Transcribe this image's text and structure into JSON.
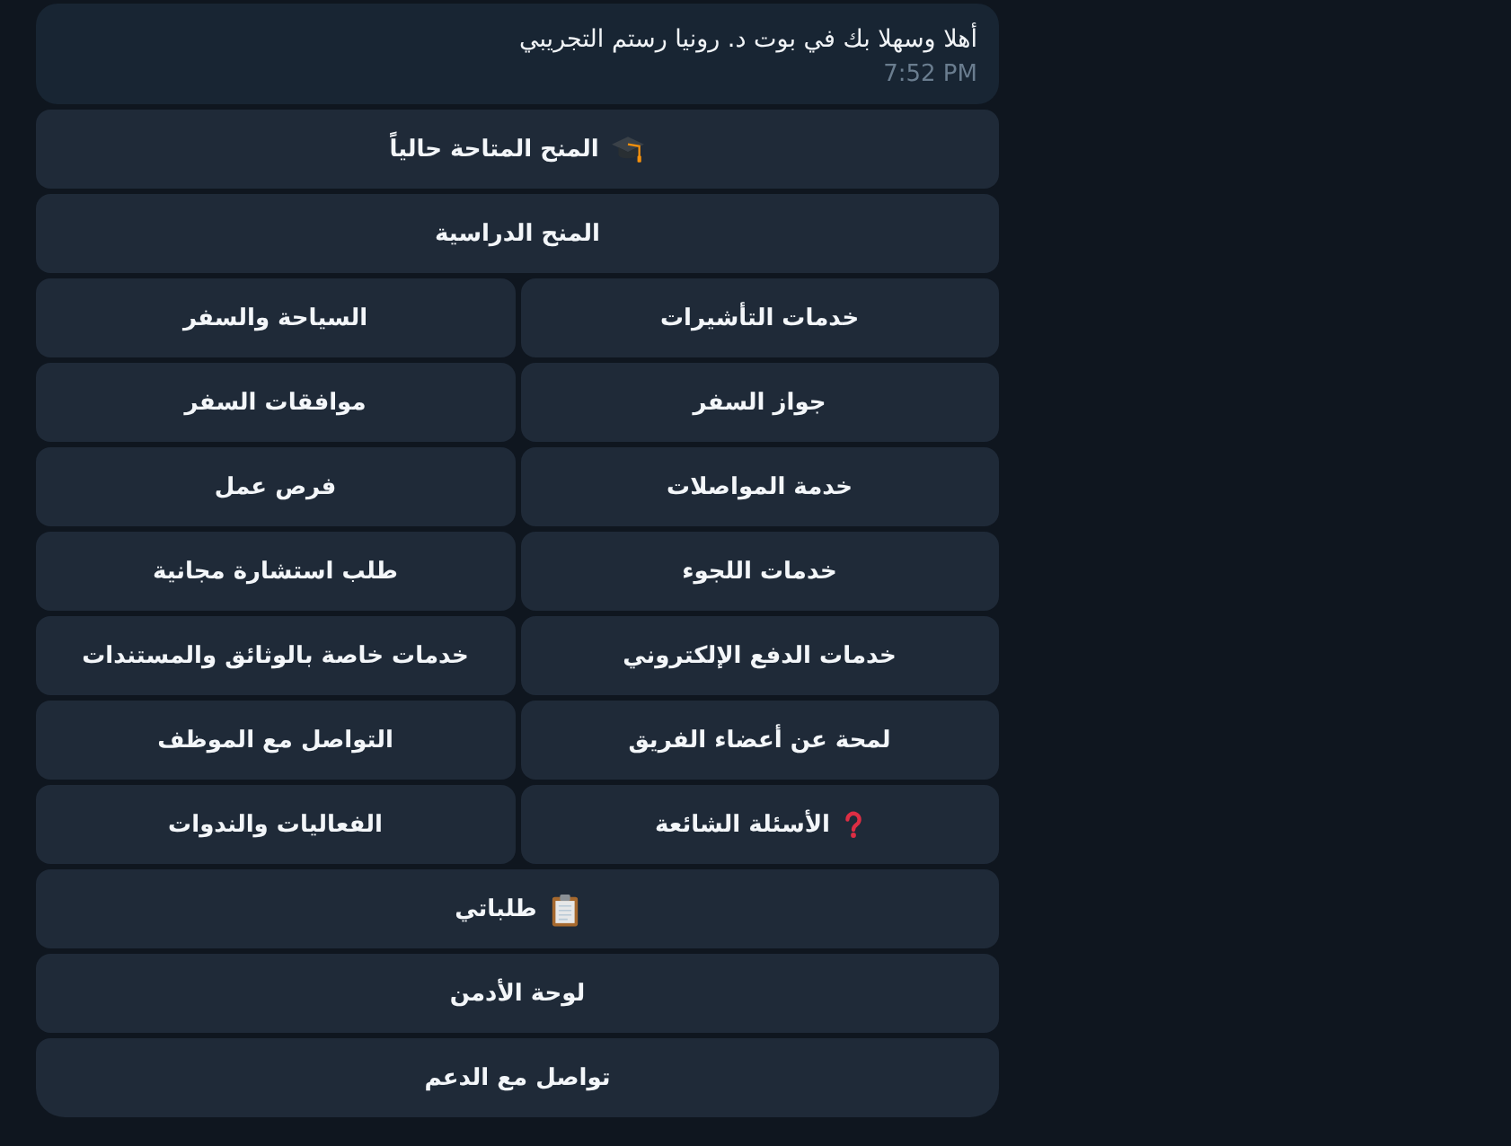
{
  "message": {
    "text": "أهلا وسهلا بك في بوت د. رونيا رستم التجريبي",
    "time": "7:52 PM"
  },
  "keyboard": {
    "rows": [
      [
        {
          "label": "المنح المتاحة حالياً",
          "kind": "cap"
        }
      ],
      [
        {
          "label": "المنح الدراسية",
          "kind": "plain"
        }
      ],
      [
        {
          "label": "خدمات التأشيرات",
          "kind": "plain"
        },
        {
          "label": "السياحة والسفر",
          "kind": "plain"
        }
      ],
      [
        {
          "label": "جواز السفر",
          "kind": "plain"
        },
        {
          "label": "موافقات السفر",
          "kind": "plain"
        }
      ],
      [
        {
          "label": "خدمة المواصلات",
          "kind": "plain"
        },
        {
          "label": "فرص عمل",
          "kind": "plain"
        }
      ],
      [
        {
          "label": "خدمات اللجوء",
          "kind": "plain"
        },
        {
          "label": "طلب استشارة مجانية",
          "kind": "plain"
        }
      ],
      [
        {
          "label": "خدمات الدفع الإلكتروني",
          "kind": "plain"
        },
        {
          "label": "خدمات خاصة بالوثائق والمستندات",
          "kind": "plain"
        }
      ],
      [
        {
          "label": "لمحة عن أعضاء الفريق",
          "kind": "plain"
        },
        {
          "label": "التواصل مع الموظف",
          "kind": "plain"
        }
      ],
      [
        {
          "label": "الأسئلة الشائعة",
          "kind": "question"
        },
        {
          "label": "الفعاليات والندوات",
          "kind": "plain"
        }
      ],
      [
        {
          "label": "طلباتي",
          "kind": "clipboard"
        }
      ],
      [
        {
          "label": "لوحة الأدمن",
          "kind": "plain"
        }
      ],
      [
        {
          "label": "تواصل مع الدعم",
          "kind": "plain"
        }
      ]
    ]
  }
}
